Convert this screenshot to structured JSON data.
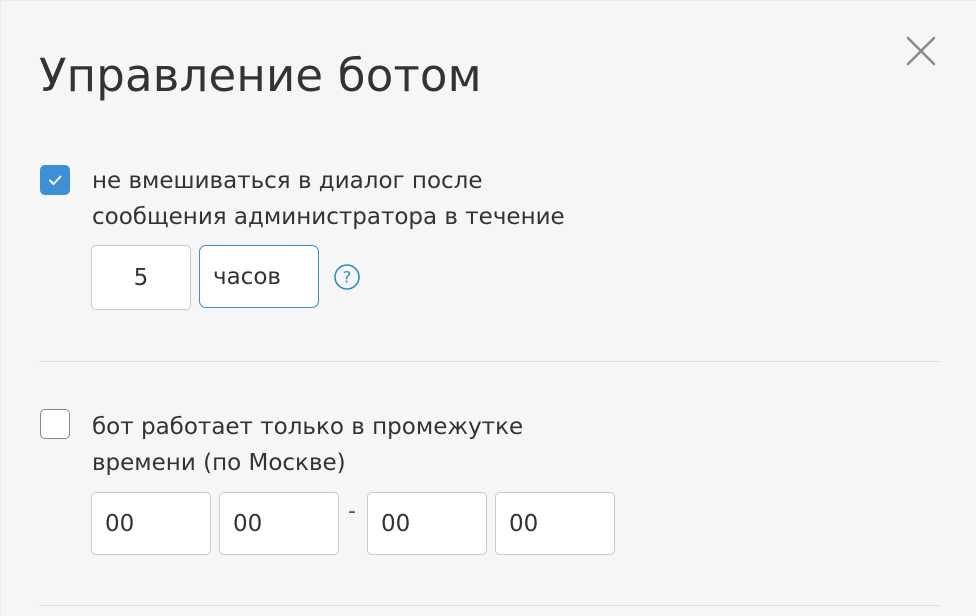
{
  "dialog": {
    "title": "Управление ботом",
    "close_icon": "close-icon"
  },
  "option_admin_pause": {
    "checked": true,
    "label_line1": "не вмешиваться в диалог после",
    "label_line2": "сообщения администратора в течение",
    "duration_value": "5",
    "duration_unit": "часов",
    "help_icon": "help-icon"
  },
  "option_schedule": {
    "checked": false,
    "label_line1": "бот работает только в промежутке",
    "label_line2": "времени (по Москве)",
    "start_hours": "00",
    "start_minutes": "00",
    "separator": "-",
    "end_hours": "00",
    "end_minutes": "00"
  },
  "colors": {
    "accent": "#3d8fd6",
    "select_border": "#3b8fc3",
    "text": "#333333",
    "background": "#f6f6f6"
  }
}
